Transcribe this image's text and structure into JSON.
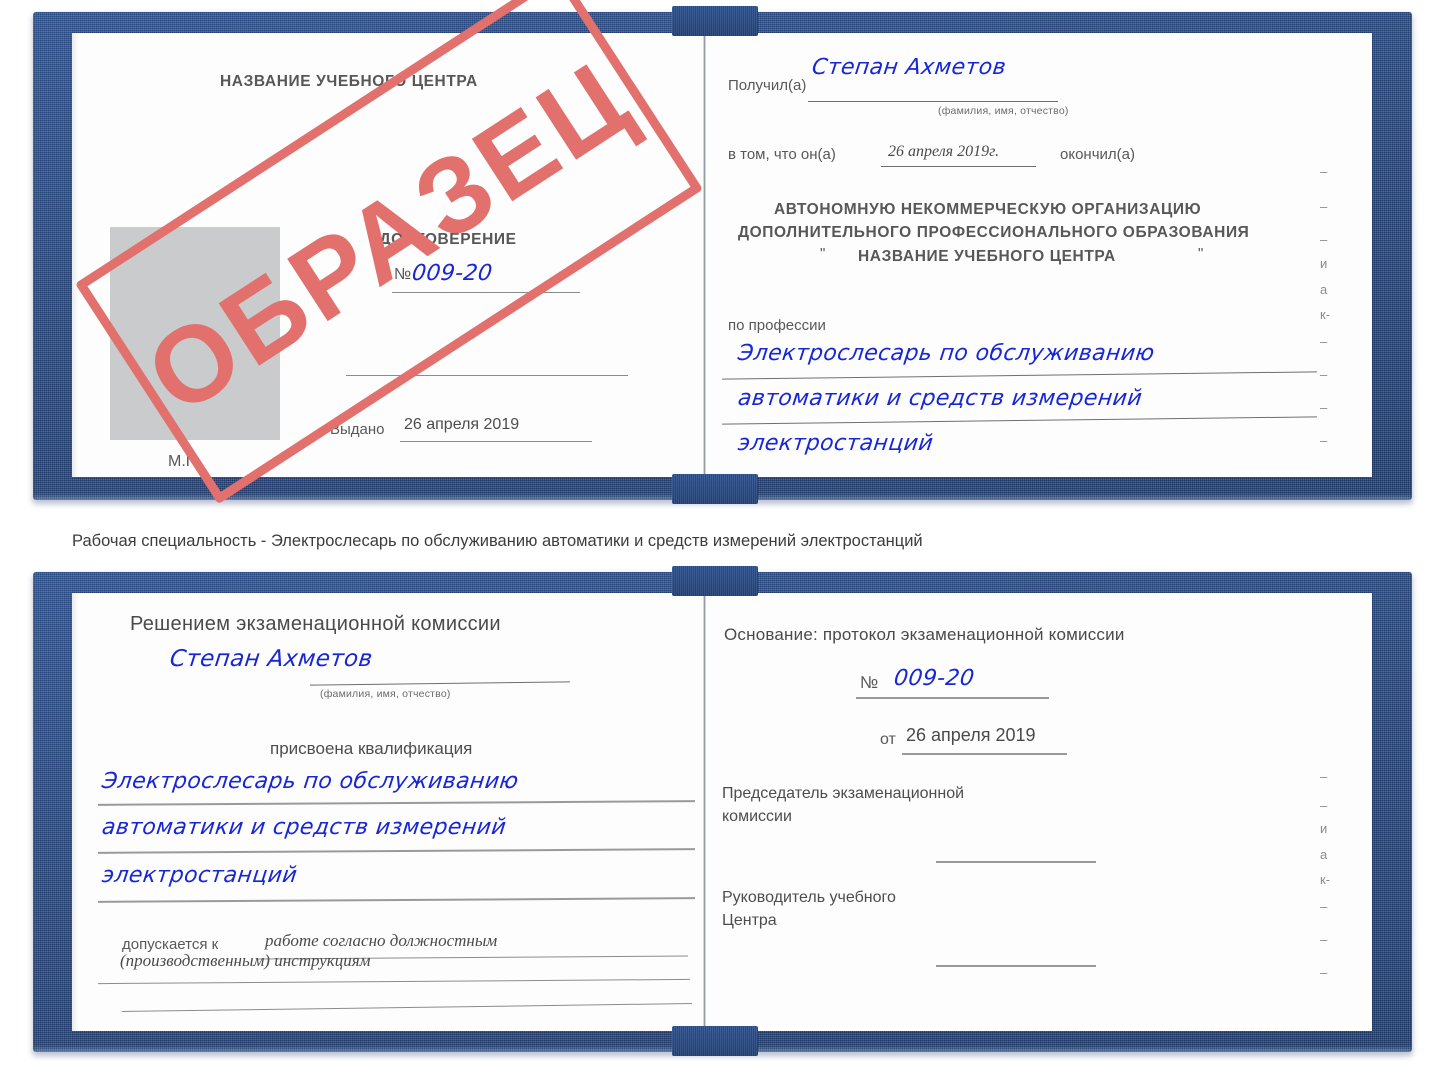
{
  "watermark": {
    "text": "ОБРАЗЕЦ",
    "color": "#e2706d"
  },
  "colors": {
    "cover_blue": "#27477f",
    "handwriting_blue": "#1726d6",
    "photo_placeholder_gray": "#c9cbcc"
  },
  "caption": {
    "text": "Рабочая специальность - Электрослесарь по обслуживанию автоматики и средств измерений электростанций"
  },
  "certificate_top": {
    "left_page": {
      "org_title": "НАЗВАНИЕ УЧЕБНОГО ЦЕНТРА",
      "doc_title": "УДОСТОВЕРЕНИЕ",
      "number_symbol": "№",
      "number_value": "009-20",
      "issued_label": "Выдано",
      "issued_value": "26 апреля 2019",
      "seal_label": "М.П.",
      "photo_placeholder": "photo-placeholder"
    },
    "right_page": {
      "received_label": "Получил(а)",
      "received_value": "Степан Ахметов",
      "fio_hint": "(фамилия, имя, отчество)",
      "in_that_label": "в том, что он(а)",
      "in_that_value": "26 апреля 2019г.",
      "finished_label": "окончил(а)",
      "org_line1": "АВТОНОМНУЮ НЕКОММЕРЧЕСКУЮ ОРГАНИЗАЦИЮ",
      "org_line2": "ДОПОЛНИТЕЛЬНОГО ПРОФЕССИОНАЛЬНОГО ОБРАЗОВАНИЯ",
      "org_quote_open": "\"",
      "org_line3": "НАЗВАНИЕ УЧЕБНОГО ЦЕНТРА",
      "org_quote_close": "\"",
      "profession_label": "по профессии",
      "profession_line1": "Электрослесарь по обслуживанию",
      "profession_line2": "автоматики и средств измерений",
      "profession_line3": "электростанций",
      "edge_fragments": [
        "и",
        "а",
        "к-"
      ]
    }
  },
  "certificate_bottom": {
    "left_page": {
      "commission_decision": "Решением экзаменационной комиссии",
      "name_value": "Степан Ахметов",
      "fio_hint": "(фамилия, имя, отчество)",
      "qualification_label": "присвоена квалификация",
      "qualification_line1": "Электрослесарь по обслуживанию",
      "qualification_line2": "автоматики и средств измерений",
      "qualification_line3": "электростанций",
      "admitted_label": "допускается к",
      "admitted_value1": "работе согласно должностным",
      "admitted_value2": "(производственным) инструкциям"
    },
    "right_page": {
      "basis_label": "Основание: протокол экзаменационной комиссии",
      "number_symbol": "№",
      "number_value": "009-20",
      "date_label": "от",
      "date_value": "26 апреля 2019",
      "chairman_line1": "Председатель экзаменационной",
      "chairman_line2": "комиссии",
      "head_line1": "Руководитель учебного",
      "head_line2": "Центра",
      "edge_fragments": [
        "и",
        "а",
        "к-"
      ]
    }
  }
}
